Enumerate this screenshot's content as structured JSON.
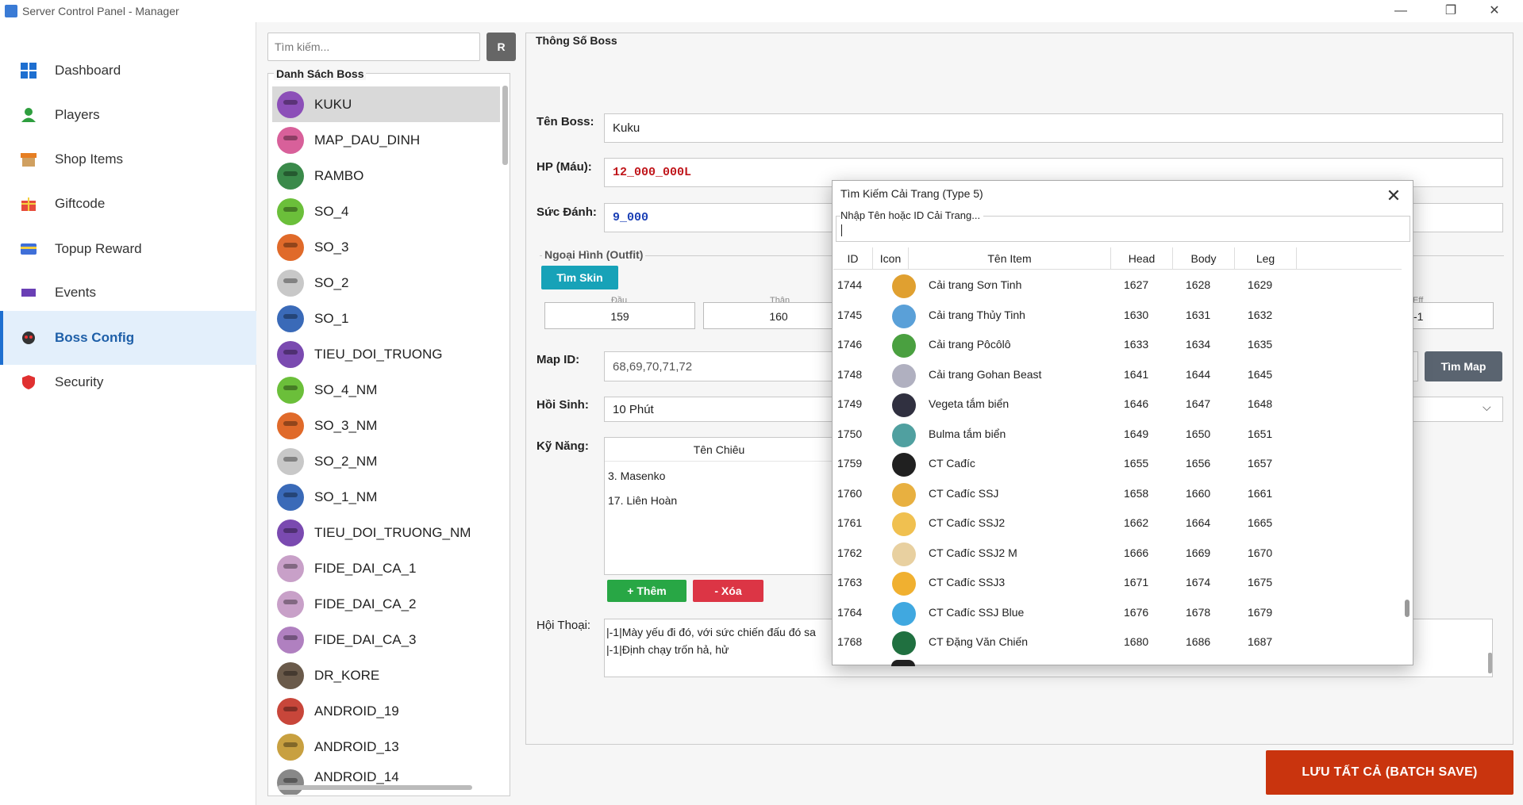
{
  "window": {
    "title": "Server Control Panel - Manager",
    "min": "—",
    "max": "❐",
    "close": "✕"
  },
  "sidebar": {
    "items": [
      {
        "label": "Dashboard",
        "icon": "grid-icon",
        "color": "#1e6fd0"
      },
      {
        "label": "Players",
        "icon": "user-icon",
        "color": "#2e9e3e"
      },
      {
        "label": "Shop Items",
        "icon": "shop-icon",
        "color": "#e67e22"
      },
      {
        "label": "Giftcode",
        "icon": "gift-icon",
        "color": "#e74c3c"
      },
      {
        "label": "Topup Reward",
        "icon": "card-icon",
        "color": "#3f6fd8"
      },
      {
        "label": "Events",
        "icon": "flag-icon",
        "color": "#6a3fb5"
      },
      {
        "label": "Boss Config",
        "icon": "boss-icon",
        "color": "#333333"
      },
      {
        "label": "Security",
        "icon": "shield-icon",
        "color": "#e03030"
      }
    ],
    "active": 6
  },
  "bosslist": {
    "search_placeholder": "Tìm kiếm...",
    "refresh_label": "R",
    "title": "Danh Sách Boss",
    "items": [
      "KUKU",
      "MAP_DAU_DINH",
      "RAMBO",
      "SO_4",
      "SO_3",
      "SO_2",
      "SO_1",
      "TIEU_DOI_TRUONG",
      "SO_4_NM",
      "SO_3_NM",
      "SO_2_NM",
      "SO_1_NM",
      "TIEU_DOI_TRUONG_NM",
      "FIDE_DAI_CA_1",
      "FIDE_DAI_CA_2",
      "FIDE_DAI_CA_3",
      "DR_KORE",
      "ANDROID_19",
      "ANDROID_13",
      "ANDROID_14"
    ],
    "avatar_colors": [
      "#8c4fb8",
      "#d8609a",
      "#3a8a4a",
      "#6bbf3a",
      "#e06a2a",
      "#c8c8c8",
      "#3a6ab8",
      "#7a4ab0",
      "#6bbf3a",
      "#e06a2a",
      "#c8c8c8",
      "#3a6ab8",
      "#7a4ab0",
      "#c8a0c8",
      "#c8a0c8",
      "#b080c0",
      "#6a5a4a",
      "#c8463a",
      "#c8a040",
      "#888888"
    ],
    "selected": 0
  },
  "main": {
    "title": "Thông Số Boss",
    "name_label": "Tên Boss:",
    "name_value": "Kuku",
    "hp_label": "HP (Máu):",
    "hp_value": "12_000_000L",
    "dmg_label": "Sức Đánh:",
    "dmg_value": "9_000",
    "outfit_label": "Ngoại Hình (Outfit)",
    "skin_button": "Tìm Skin",
    "head_label": "Đầu",
    "head_value": "159",
    "body_label": "Thân",
    "body_value": "160",
    "eff_label": "Eff",
    "eff_value": "-1",
    "map_label": "Map ID:",
    "map_value": "68,69,70,71,72",
    "map_button": "Tìm Map",
    "respawn_label": "Hồi Sinh:",
    "respawn_value": "10 Phút",
    "skill_label": "Kỹ Năng:",
    "skill_col": "Tên Chiêu",
    "skills": [
      "3. Masenko",
      "17. Liên Hoàn"
    ],
    "add_button": "+ Thêm",
    "del_button": "- Xóa",
    "chat_label": "Hội Thoại:",
    "chat_lines": [
      "|-1|Mày yếu đi đó, với sức chiến đấu đó sa",
      "|-1|Định chạy trốn hả, hử"
    ],
    "save_button": "LƯU TẤT CẢ (BATCH SAVE)"
  },
  "dialog": {
    "title": "Tìm Kiếm Cải Trang (Type 5)",
    "close": "✕",
    "search_label": "Nhập Tên hoặc ID Cải Trang...",
    "columns": [
      "ID",
      "Icon",
      "Tên Item",
      "Head",
      "Body",
      "Leg"
    ],
    "rows": [
      {
        "id": "1744",
        "name": "Cải trang Sơn Tinh",
        "head": "1627",
        "body": "1628",
        "leg": "1629",
        "color": "#e0a030"
      },
      {
        "id": "1745",
        "name": "Cải trang Thủy Tinh",
        "head": "1630",
        "body": "1631",
        "leg": "1632",
        "color": "#5aa0d8"
      },
      {
        "id": "1746",
        "name": "Cải trang Pôcôlô",
        "head": "1633",
        "body": "1634",
        "leg": "1635",
        "color": "#4aa040"
      },
      {
        "id": "1748",
        "name": " Cải trang Gohan Beast",
        "head": "1641",
        "body": "1644",
        "leg": "1645",
        "color": "#b0b0c0"
      },
      {
        "id": "1749",
        "name": "Vegeta tắm biển",
        "head": "1646",
        "body": "1647",
        "leg": "1648",
        "color": "#303040"
      },
      {
        "id": "1750",
        "name": "Bulma tắm biển",
        "head": "1649",
        "body": "1650",
        "leg": "1651",
        "color": "#50a0a0"
      },
      {
        "id": "1759",
        "name": "CT Cađíc",
        "head": "1655",
        "body": "1656",
        "leg": "1657",
        "color": "#202020"
      },
      {
        "id": "1760",
        "name": "CT Cađíc SSJ",
        "head": "1658",
        "body": "1660",
        "leg": "1661",
        "color": "#e8b040"
      },
      {
        "id": "1761",
        "name": "CT Cađíc SSJ2",
        "head": "1662",
        "body": "1664",
        "leg": "1665",
        "color": "#f0c050"
      },
      {
        "id": "1762",
        "name": "CT Cađíc SSJ2 M",
        "head": "1666",
        "body": "1669",
        "leg": "1670",
        "color": "#e8d0a0"
      },
      {
        "id": "1763",
        "name": "CT Cađíc SSJ3",
        "head": "1671",
        "body": "1674",
        "leg": "1675",
        "color": "#f0b030"
      },
      {
        "id": "1764",
        "name": "CT Cađíc SSJ Blue",
        "head": "1676",
        "body": "1678",
        "leg": "1679",
        "color": "#40a8e0"
      },
      {
        "id": "1768",
        "name": "CT Đặng Văn Chiến",
        "head": "1680",
        "body": "1686",
        "leg": "1687",
        "color": "#207040"
      }
    ]
  }
}
